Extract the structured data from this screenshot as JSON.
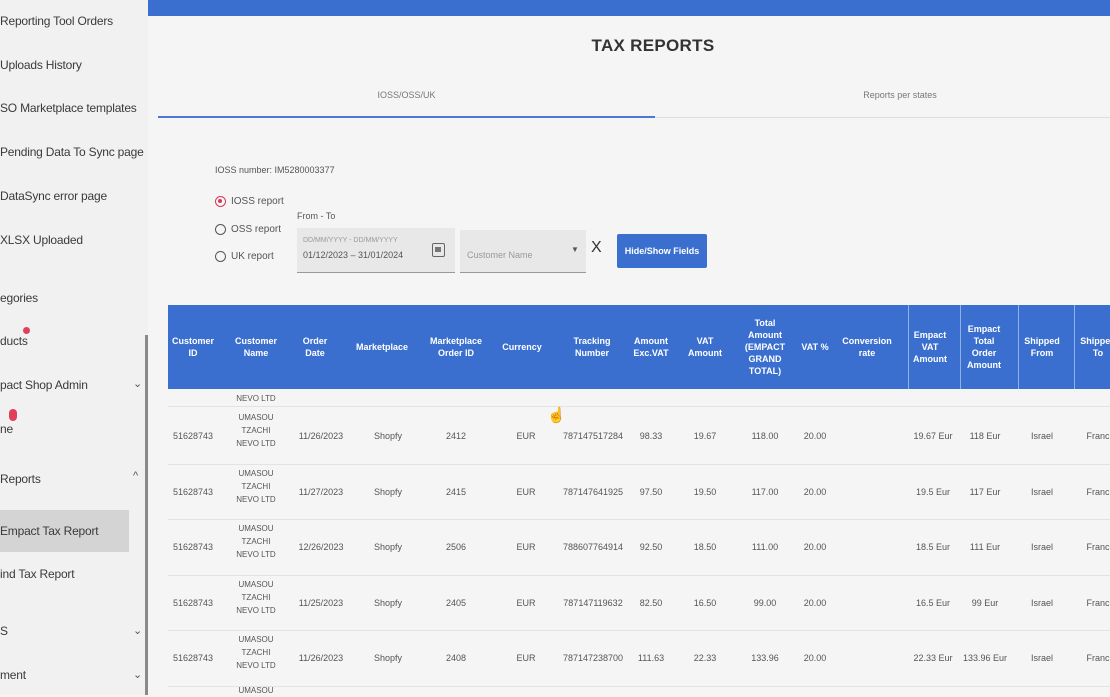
{
  "sidebar": {
    "items": [
      {
        "label": "Reporting Tool Orders"
      },
      {
        "label": "Uploads History"
      },
      {
        "label": "SO Marketplace templates"
      },
      {
        "label": "Pending Data To Sync page"
      },
      {
        "label": "DataSync error page"
      },
      {
        "label": "XLSX Uploaded"
      },
      {
        "label": "egories"
      },
      {
        "label": "ducts"
      },
      {
        "label": "pact Shop Admin"
      },
      {
        "label": "ne"
      },
      {
        "label": " Reports"
      },
      {
        "label": "Empact Tax Report"
      },
      {
        "label": "ind Tax Report"
      },
      {
        "label": "S"
      },
      {
        "label": "ment"
      }
    ],
    "chevrons": {
      "down": "⌄",
      "up": "^"
    }
  },
  "page": {
    "title": "TAX REPORTS",
    "tabs": [
      {
        "label": "IOSS/OSS/UK"
      },
      {
        "label": "Reports per states"
      }
    ]
  },
  "filters": {
    "ioss_number": "IOSS number: IM5280003377",
    "radios": [
      {
        "label": "IOSS report",
        "selected": true
      },
      {
        "label": "OSS report",
        "selected": false
      },
      {
        "label": "UK report",
        "selected": false
      }
    ],
    "from_to_label": "From - To",
    "date_placeholder": "DD/MM/YYYY - DD/MM/YYYY",
    "date_value": "01/12/2023 – 31/01/2024",
    "customer_placeholder": "Customer Name",
    "caret": "▼",
    "clear": "X",
    "hide_show_button": "Hide/Show Fields"
  },
  "table": {
    "headers": [
      "Customer ID",
      "Customer Name",
      "Order Date",
      "Marketplace",
      "Marketplace Order ID",
      "Currency",
      "Tracking Number",
      "Amount Exc.VAT",
      "VAT Amount",
      "Total Amount (EMPACT GRAND TOTAL)",
      "VAT %",
      "Conversion rate",
      "Empact VAT Amount",
      "Empact Total Order Amount",
      "Shipped From",
      "Shipped To"
    ],
    "top_partial_name": "NEVO LTD",
    "rows": [
      {
        "customer_id": "51628743",
        "name": [
          "UMASOU",
          "TZACHI",
          "NEVO LTD"
        ],
        "order_date": "11/26/2023",
        "marketplace": "Shopfy",
        "mp_order_id": "2412",
        "currency": "EUR",
        "tracking": "787147517284",
        "amount_exc": "98.33",
        "vat_amount": "19.67",
        "total": "118.00",
        "vat_pct": "20.00",
        "conv": "",
        "empact_vat": "19.67 Eur",
        "empact_total": "118 Eur",
        "from": "Israel",
        "to": "Franc"
      },
      {
        "customer_id": "51628743",
        "name": [
          "UMASOU",
          "TZACHI",
          "NEVO LTD"
        ],
        "order_date": "11/27/2023",
        "marketplace": "Shopfy",
        "mp_order_id": "2415",
        "currency": "EUR",
        "tracking": "787147641925",
        "amount_exc": "97.50",
        "vat_amount": "19.50",
        "total": "117.00",
        "vat_pct": "20.00",
        "conv": "",
        "empact_vat": "19.5 Eur",
        "empact_total": "117 Eur",
        "from": "Israel",
        "to": "Franc"
      },
      {
        "customer_id": "51628743",
        "name": [
          "UMASOU",
          "TZACHI",
          "NEVO LTD"
        ],
        "order_date": "12/26/2023",
        "marketplace": "Shopfy",
        "mp_order_id": "2506",
        "currency": "EUR",
        "tracking": "788607764914",
        "amount_exc": "92.50",
        "vat_amount": "18.50",
        "total": "111.00",
        "vat_pct": "20.00",
        "conv": "",
        "empact_vat": "18.5 Eur",
        "empact_total": "111 Eur",
        "from": "Israel",
        "to": "Franc"
      },
      {
        "customer_id": "51628743",
        "name": [
          "UMASOU",
          "TZACHI",
          "NEVO LTD"
        ],
        "order_date": "11/25/2023",
        "marketplace": "Shopfy",
        "mp_order_id": "2405",
        "currency": "EUR",
        "tracking": "787147119632",
        "amount_exc": "82.50",
        "vat_amount": "16.50",
        "total": "99.00",
        "vat_pct": "20.00",
        "conv": "",
        "empact_vat": "16.5 Eur",
        "empact_total": "99 Eur",
        "from": "Israel",
        "to": "Franc"
      },
      {
        "customer_id": "51628743",
        "name": [
          "UMASOU",
          "TZACHI",
          "NEVO LTD"
        ],
        "order_date": "11/26/2023",
        "marketplace": "Shopfy",
        "mp_order_id": "2408",
        "currency": "EUR",
        "tracking": "787147238700",
        "amount_exc": "111.63",
        "vat_amount": "22.33",
        "total": "133.96",
        "vat_pct": "20.00",
        "conv": "",
        "empact_vat": "22.33 Eur",
        "empact_total": "133.96 Eur",
        "from": "Israel",
        "to": "Franc"
      }
    ],
    "bottom_partial_name": "UMASOU"
  },
  "colors": {
    "accent": "#3a6fd0",
    "radio_selected": "#d33a58"
  }
}
